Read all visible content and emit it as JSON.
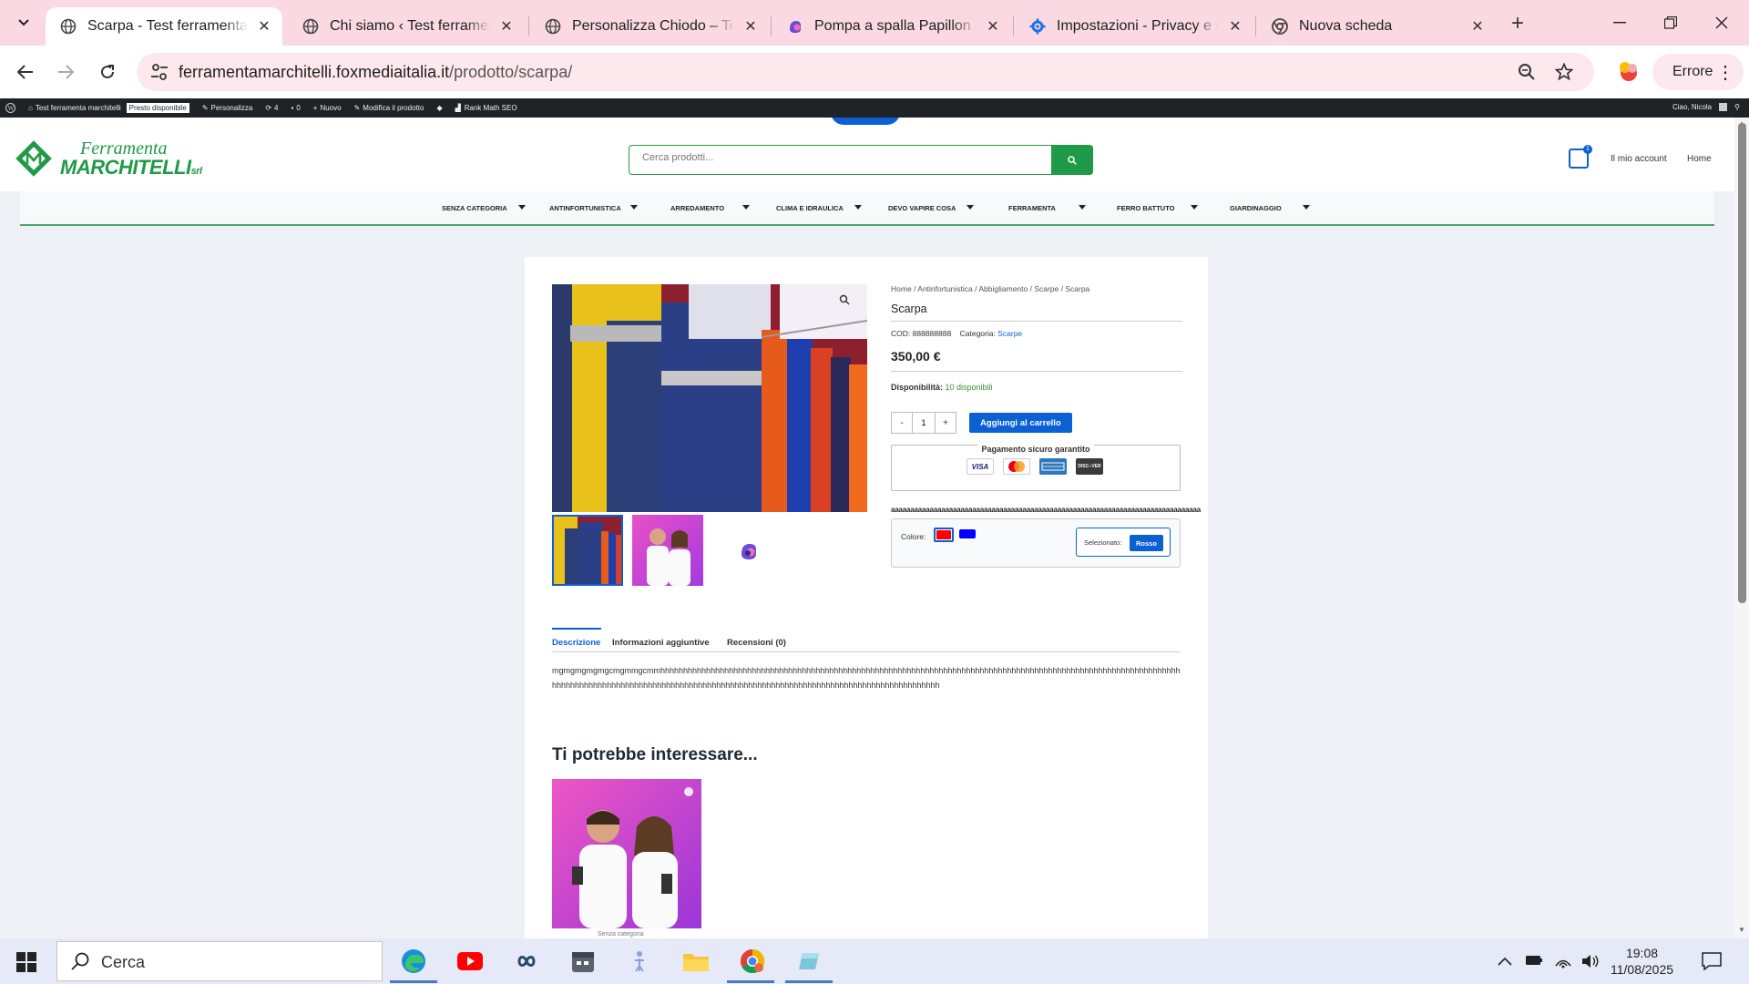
{
  "browser": {
    "tabs": [
      {
        "title": "Scarpa - Test ferramenta marchitelli",
        "active": true,
        "icon": "globe-icon"
      },
      {
        "title": "Chi siamo ‹ Test ferramenta marchitelli",
        "active": false,
        "icon": "globe-icon"
      },
      {
        "title": "Personalizza Chiodo – Test",
        "active": false,
        "icon": "globe-icon"
      },
      {
        "title": "Pompa a spalla Papillon con",
        "active": false,
        "icon": "copilot-icon"
      },
      {
        "title": "Impostazioni - Privacy e sicurezza",
        "active": false,
        "icon": "gear-icon"
      },
      {
        "title": "Nuova scheda",
        "active": false,
        "icon": "chrome-icon"
      }
    ],
    "url_host": "ferramentamarchitelli.foxmediaitalia.it",
    "url_path": "/prodotto/scarpa/",
    "error_label": "Errore"
  },
  "adminbar": {
    "site": "Test ferramenta marchitelli",
    "soon": "Presto disponibile",
    "customize": "Personalizza",
    "updates": "4",
    "comments": "0",
    "new": "Nuovo",
    "edit": "Modifica il prodotto",
    "rankmath": "Rank Math SEO",
    "greeting": "Ciao, Nicola"
  },
  "header": {
    "logo_line1": "Ferramenta",
    "logo_line2": "MARCHITELLI",
    "logo_srl": "srl",
    "search_placeholder": "Cerca prodotti...",
    "cart_count": "1",
    "account_link": "Il mio account",
    "home_link": "Home"
  },
  "menu": [
    "SENZA CATEGORIA",
    "ANTINFORTUNISTICA",
    "ARREDAMENTO",
    "CLIMA E IDRAULICA",
    "DEVO VAPIRE COSA",
    "FERRAMENTA",
    "FERRO BATTUTO",
    "GIARDINAGGIO"
  ],
  "product": {
    "breadcrumb": "Home / Antinfortunistica / Abbigliamento / Scarpe / Scarpa",
    "title": "Scarpa",
    "cod_label": "COD:",
    "cod": "888888888",
    "category_label": "Categoria:",
    "category": "Scarpe",
    "price": "350,00 €",
    "availability_label": "Disponibilità:",
    "availability": "10 disponibili",
    "qty_minus": "-",
    "qty": "1",
    "qty_plus": "+",
    "add_to_cart": "Aggiungi al carrello",
    "payment_title": "Pagamento sicuro garantito",
    "payment_cards": [
      "VISA",
      "mastercard",
      "AMERICAN EXPRESS",
      "DISCOVER"
    ],
    "long_text": "aaaaaaaaaaaaaaaaaaaaaaaaaaaaaaaaaaaaaaaaaaaaaaaaaaaaaaaaaaaaaaaaaaaaaaaaaaaaaaaa",
    "color_label": "Colore:",
    "colors": [
      "#ff0000",
      "#0000ff"
    ],
    "selected_label": "Selezionato:",
    "selected_value": "Rosso"
  },
  "tabs": {
    "description": "Descrizione",
    "additional": "Informazioni aggiuntive",
    "reviews": "Recensioni (0)"
  },
  "description_text": "mgmgmgmgmgcmgmmgcmmhhhhhhhhhhhhhhhhhhhhhhhhhhhhhhhhhhhhhhhhhhhhhhhhhhhhhhhhhhhhhhhhhhhhhhhhhhhhhhhhhhhhhhhhhhhhhhhhhhhhhhhhhhhhhhhhhhhhhhhhhhhhhhhhhhhhhhhhhhhhhhhhhhhhhhhhhhhhhhhhhhhhhhhhhhhhhhhhhhhhhhhhhhhhhhhhhhhhhhh",
  "related": {
    "title": "Ti potrebbe interessare...",
    "category": "Senza categoria"
  },
  "taskbar": {
    "search": "Cerca",
    "time": "19:08",
    "date": "11/08/2025"
  },
  "colors": {
    "accent_blue": "#0b61d4",
    "brand_green": "#1e9a48",
    "tab_strip": "#fad9e2"
  }
}
